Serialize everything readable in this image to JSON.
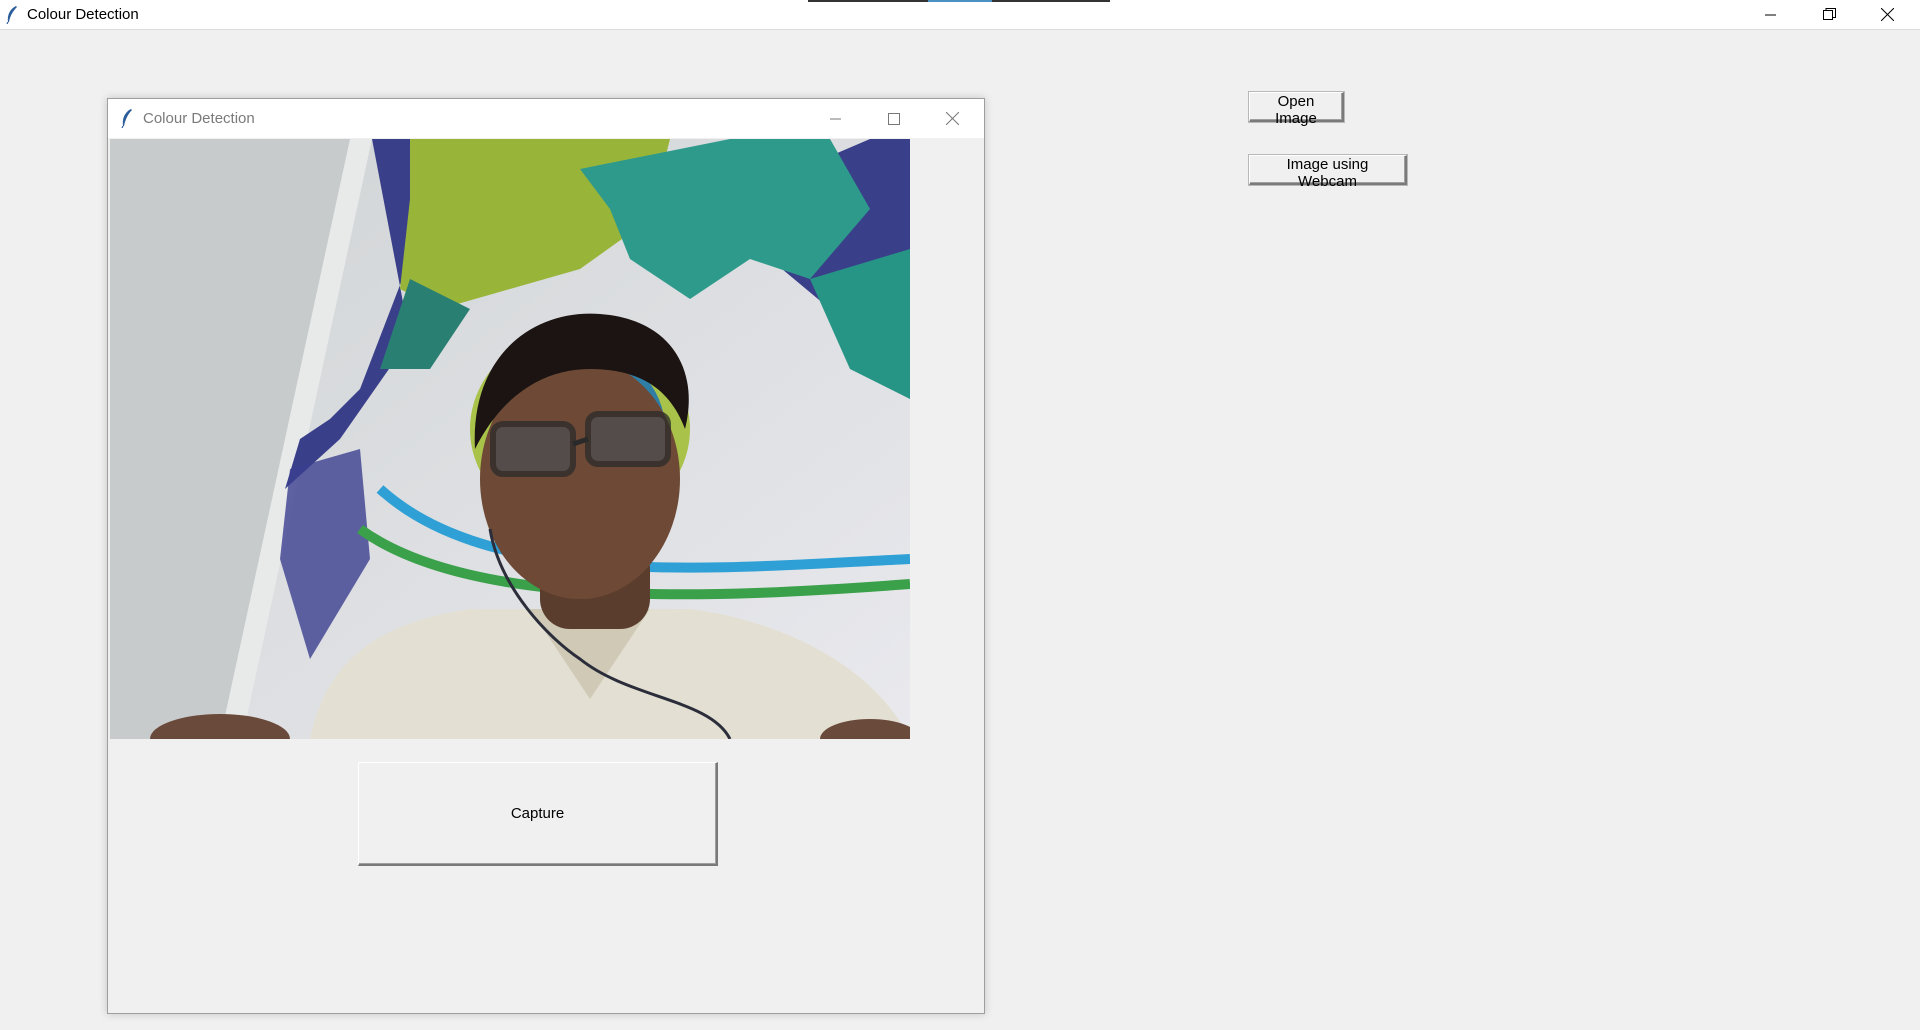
{
  "main_window": {
    "title": "Colour Detection",
    "controls": {
      "minimize": "minimize-icon",
      "restore": "restore-icon",
      "close": "close-icon"
    }
  },
  "child_window": {
    "title": "Colour Detection",
    "controls": {
      "minimize": "minimize-icon",
      "maximize": "maximize-icon",
      "close": "close-icon"
    },
    "capture_label": "Capture"
  },
  "buttons": {
    "open_image": "Open Image",
    "image_using_webcam": "Image using Webcam"
  },
  "colors": {
    "window_bg": "#f0f0f0",
    "titlebar_bg": "#ffffff"
  }
}
